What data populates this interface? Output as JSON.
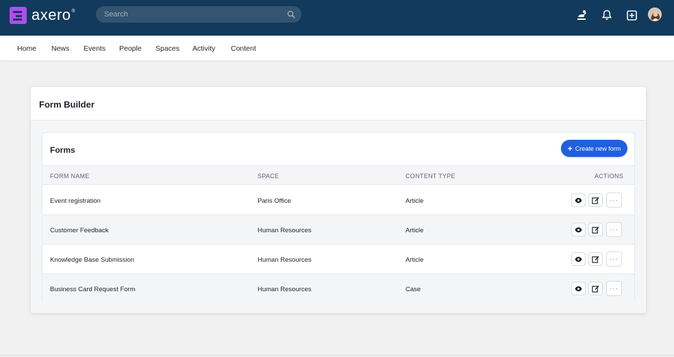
{
  "brand": {
    "name": "axero",
    "tm": "®",
    "color": "#b14cf0"
  },
  "search": {
    "placeholder": "Search"
  },
  "topbar_icons": [
    "task-icon",
    "bell-icon",
    "add-square-icon"
  ],
  "nav": {
    "items": [
      "Home",
      "News",
      "Events",
      "People",
      "Spaces",
      "Activity",
      "Content"
    ]
  },
  "page": {
    "title": "Form Builder"
  },
  "forms": {
    "title": "Forms",
    "create_label": "Create new form",
    "columns": [
      "FORM NAME",
      "SPACE",
      "CONTENT TYPE",
      "ACTIONS"
    ],
    "rows": [
      {
        "name": "Event registration",
        "space": "Paris Office",
        "type": "Article"
      },
      {
        "name": "Customer Feedback",
        "space": "Human Resources",
        "type": "Article"
      },
      {
        "name": "Knowledge Base Submission",
        "space": "Human Resources",
        "type": "Article"
      },
      {
        "name": "Business Card Request Form",
        "space": "Human Resources",
        "type": "Case"
      }
    ],
    "action_icons": [
      "view-icon",
      "edit-icon",
      "more-icon"
    ],
    "more_label": "···"
  },
  "colors": {
    "topbar": "#123a5c",
    "accent": "#1f5fe0"
  }
}
